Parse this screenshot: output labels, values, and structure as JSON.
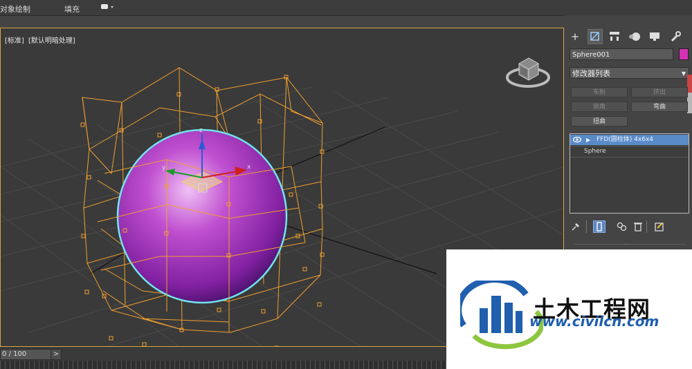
{
  "topbar": {
    "item1": "对象绘制",
    "item2": "填充"
  },
  "viewport": {
    "label1": "[标准]",
    "label2": "[默认明暗处理]"
  },
  "axes": {
    "z": "z",
    "x": "x",
    "y": "y"
  },
  "status": {
    "frame": "0 / 100",
    "next": ">"
  },
  "panel": {
    "object_name": "Sphere001",
    "object_color": "#d431b7",
    "modifier_list": "修改器列表",
    "buttons": {
      "lathe": "车削",
      "extrude": "挤出",
      "chamfer": "倒角",
      "bend": "弯曲",
      "twist": "扭曲"
    },
    "stack": {
      "selected": "FFD(圆柱体) 4x6x4",
      "base": "Sphere"
    },
    "grip": "....."
  },
  "watermark": {
    "title": "土木工程网",
    "url": "www.civilcn.com"
  },
  "colors": {
    "lattice": "#f0a030",
    "selection": "#6fe6f0",
    "sphere": "#b040c8"
  }
}
